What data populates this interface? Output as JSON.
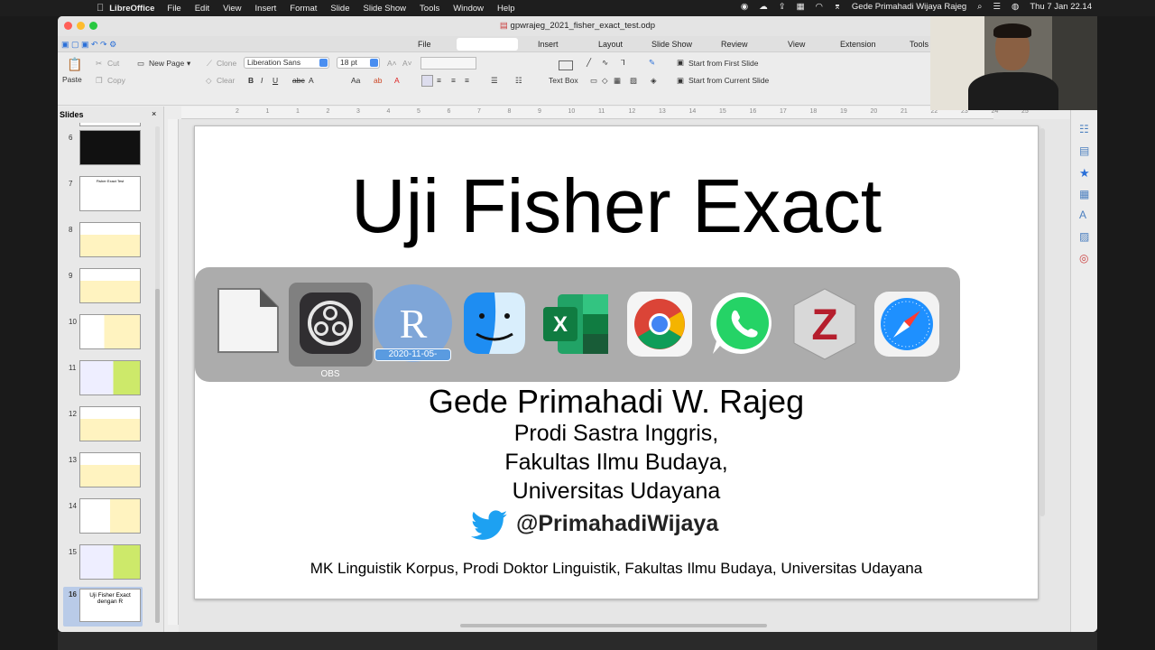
{
  "menubar": {
    "app_name": "LibreOffice",
    "items": [
      "File",
      "Edit",
      "View",
      "Insert",
      "Format",
      "Slide",
      "Slide Show",
      "Tools",
      "Window",
      "Help"
    ],
    "user": "Gede Primahadi Wijaya Rajeg",
    "clock": "Thu 7 Jan  22.14"
  },
  "window": {
    "title": "gpwrajeg_2021_fisher_exact_test.odp"
  },
  "notebookbar": {
    "tabs": [
      "File",
      "Insert",
      "Layout",
      "Slide Show",
      "Review",
      "View",
      "Extension",
      "Tools"
    ]
  },
  "toolbar": {
    "paste": "Paste",
    "cut": "Cut",
    "copy": "Copy",
    "new_page": "New Page",
    "clone": "Clone",
    "clear": "Clear",
    "font_name": "Liberation Sans",
    "font_size": "18 pt",
    "text_box": "Text Box",
    "start_first": "Start from First Slide",
    "start_current": "Start from Current Slide"
  },
  "slides_panel": {
    "header": "Slides",
    "numbers": [
      "6",
      "7",
      "8",
      "9",
      "10",
      "11",
      "12",
      "13",
      "14",
      "15",
      "16"
    ],
    "thumb_7_title": "Fisher Exact Test",
    "thumb_16_title": "Uji Fisher Exact dengan R"
  },
  "ruler_ticks": [
    "2",
    "1",
    "1",
    "2",
    "3",
    "4",
    "5",
    "6",
    "7",
    "8",
    "9",
    "10",
    "11",
    "12",
    "13",
    "14",
    "15",
    "16",
    "17",
    "18",
    "19",
    "20",
    "21",
    "22",
    "23",
    "24",
    "25"
  ],
  "slide": {
    "title": "Uji Fisher Exact",
    "author": "Gede Primahadi W. Rajeg",
    "affiliation_1": "Prodi Sastra Inggris,",
    "affiliation_2": "Fakultas Ilmu Budaya,",
    "affiliation_3": "Universitas Udayana",
    "twitter_handle": "@PrimahadiWijaya",
    "course": "MK Linguistik Korpus, Prodi Doktor Linguistik, Fakultas Ilmu Budaya, Universitas Udayana"
  },
  "app_switcher": {
    "apps": [
      "libreoffice-icon",
      "obs-icon",
      "r-icon",
      "finder-icon",
      "excel-icon",
      "chrome-icon",
      "whatsapp-icon",
      "zotero-icon",
      "safari-icon"
    ],
    "selected_label": "OBS",
    "r_tooltip": "2020-11-05-"
  },
  "colors": {
    "twitter": "#1da1f2",
    "accent": "#4a8ef0"
  }
}
